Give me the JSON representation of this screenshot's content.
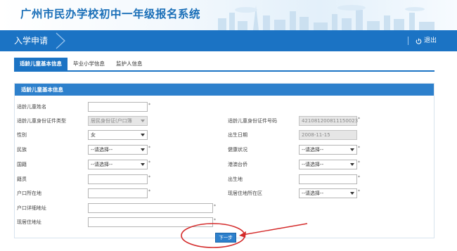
{
  "app": {
    "title": "广州市民办学校初中一年级报名系统"
  },
  "nav": {
    "current": "入学申请",
    "logout": "退出"
  },
  "tabs": [
    {
      "label": "适龄儿童基本信息",
      "active": true
    },
    {
      "label": "毕业小学信息",
      "active": false
    },
    {
      "label": "监护人信息",
      "active": false
    }
  ],
  "panel": {
    "title": "适龄儿童基本信息"
  },
  "form": {
    "child_name": {
      "label": "适龄儿童姓名",
      "value": ""
    },
    "id_type": {
      "label": "适龄儿童身份证件类型",
      "value": "居民身份证(户口簿"
    },
    "id_number": {
      "label": "适龄儿童身份证件号码",
      "value": "421081200811150023"
    },
    "gender": {
      "label": "性别",
      "value": "女"
    },
    "birth_date": {
      "label": "出生日期",
      "value": "2008-11-15"
    },
    "ethnicity": {
      "label": "民族",
      "value": "--请选择--"
    },
    "health": {
      "label": "健康状况",
      "value": "--请选择--"
    },
    "nationality": {
      "label": "国籍",
      "value": "--请选择--"
    },
    "hk_macau_tw": {
      "label": "港澳台侨",
      "value": "--请选择--"
    },
    "native_place": {
      "label": "籍贯",
      "value": ""
    },
    "birthplace": {
      "label": "出生地",
      "value": ""
    },
    "hukou_location": {
      "label": "户口所在地",
      "value": ""
    },
    "residence_district": {
      "label": "现居住地所在区",
      "value": "--请选择--"
    },
    "hukou_address": {
      "label": "户口详细地址",
      "value": ""
    },
    "residence_address": {
      "label": "现居住地址",
      "value": ""
    }
  },
  "required_mark": "*",
  "next_button": "下一步",
  "colors": {
    "primary": "#1b73c4",
    "panel_header": "#2d80cc",
    "annotation": "#d42a2a"
  }
}
